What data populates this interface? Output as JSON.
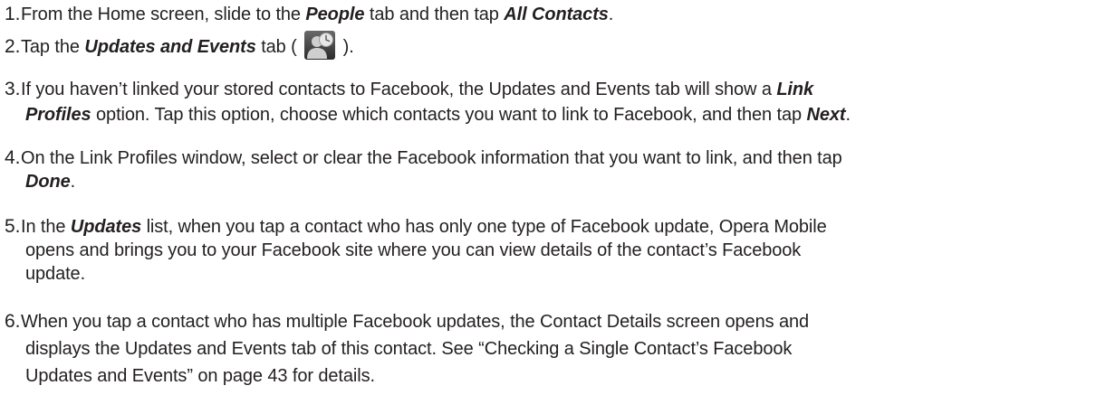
{
  "steps": [
    {
      "number": "1.",
      "segments": [
        {
          "t": "From the Home screen, slide to the "
        },
        {
          "t": "People",
          "em": true
        },
        {
          "t": " tab and then tap "
        },
        {
          "t": "All Contacts",
          "em": true
        },
        {
          "t": "."
        }
      ]
    },
    {
      "number": "2.",
      "segments": [
        {
          "t": "Tap the "
        },
        {
          "t": "Updates and Events",
          "em": true
        },
        {
          "t": " tab ( "
        },
        {
          "icon": "updates-events-tab-icon"
        },
        {
          "t": " )."
        }
      ]
    },
    {
      "number": "3.",
      "lines": [
        [
          {
            "t": "If you haven’t linked your stored contacts to Facebook, the Updates and Events tab will show a "
          },
          {
            "t": "Link",
            "em": true
          }
        ],
        [
          {
            "t": "Profiles",
            "em": true
          },
          {
            "t": " option. Tap this option, choose which contacts you want to link to Facebook, and then tap "
          },
          {
            "t": "Next",
            "em": true
          },
          {
            "t": "."
          }
        ]
      ]
    },
    {
      "number": "4.",
      "lines": [
        [
          {
            "t": "On the Link Profiles window, select or clear the Facebook information that you want to link, and then tap"
          }
        ],
        [
          {
            "t": "Done",
            "em": true
          },
          {
            "t": "."
          }
        ]
      ]
    },
    {
      "number": "5.",
      "lines": [
        [
          {
            "t": "In the "
          },
          {
            "t": "Updates",
            "em": true
          },
          {
            "t": " list, when you tap a contact who has only one type of Facebook update, Opera Mobile"
          }
        ],
        [
          {
            "t": "opens and brings you to your Facebook site where you can view details of the contact’s Facebook"
          }
        ],
        [
          {
            "t": "update."
          }
        ]
      ]
    },
    {
      "number": "6.",
      "lines": [
        [
          {
            "t": "When you tap a contact who has multiple Facebook updates, the Contact Details screen opens and"
          }
        ],
        [
          {
            "t": "displays the Updates and Events tab of this contact. See “Checking a Single Contact’s Facebook"
          }
        ],
        [
          {
            "t": "Updates and Events” on page 43 for details."
          }
        ]
      ]
    }
  ],
  "icon_colors": {
    "tile_dark": "#2b2b2b",
    "tile_light": "#6a6a6a",
    "person": "#cfcfcf",
    "clock_face": "#e8e8e8",
    "clock_hands": "#555555"
  }
}
